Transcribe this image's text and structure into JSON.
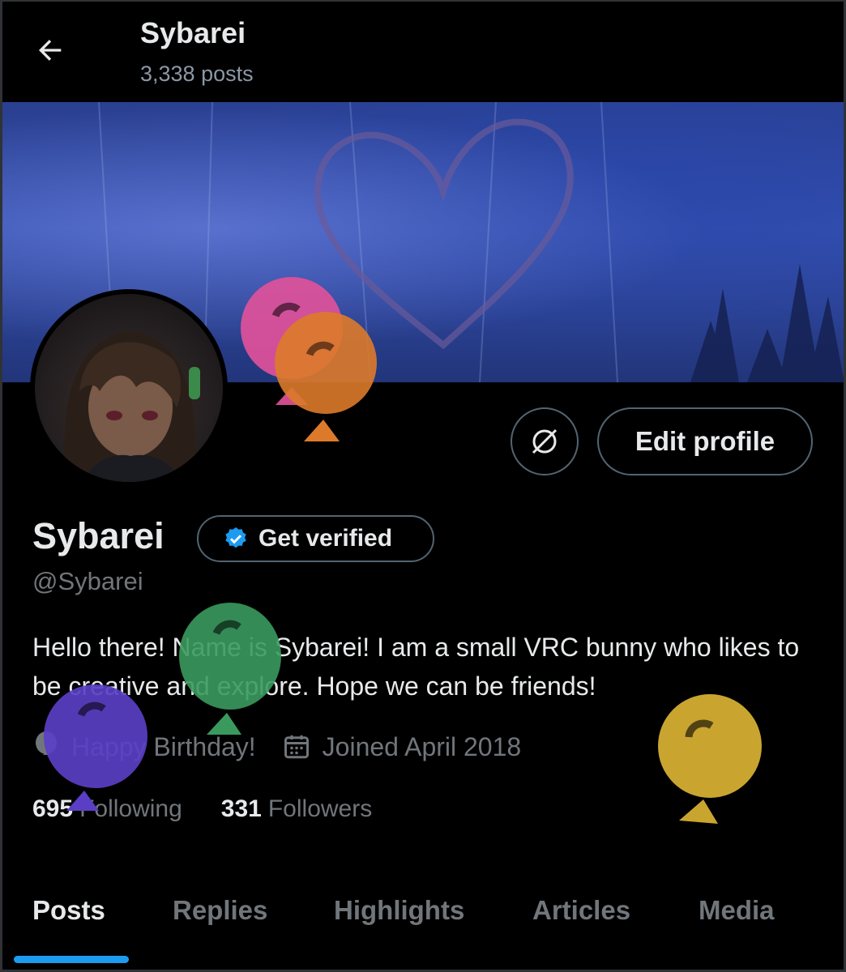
{
  "header": {
    "title": "Sybarei",
    "post_count": "3,338 posts",
    "back_icon": "arrow-left-icon"
  },
  "profile": {
    "display_name": "Sybarei",
    "handle": "@Sybarei",
    "bio": "Hello there! Name is Sybarei! I am a small VRC bunny who likes to be creative and explore. Hope we can be friends!",
    "get_verified_label": "Get verified",
    "edit_profile_label": "Edit profile",
    "birthday_text": "Happy Birthday!",
    "joined_text": "Joined April 2018",
    "following_count": "695",
    "following_label": "Following",
    "followers_count": "331",
    "followers_label": "Followers"
  },
  "tabs": [
    {
      "label": "Posts",
      "active": true
    },
    {
      "label": "Replies",
      "active": false
    },
    {
      "label": "Highlights",
      "active": false
    },
    {
      "label": "Articles",
      "active": false
    },
    {
      "label": "Media",
      "active": false
    }
  ],
  "colors": {
    "background": "#000000",
    "text_primary": "#e7e9ea",
    "text_secondary": "#71767b",
    "accent": "#1d9bf0",
    "border": "#536471",
    "balloon_pink": "#e0519a",
    "balloon_orange": "#dd7a2a",
    "balloon_green": "#3a9a5e",
    "balloon_purple": "#5a3fc4",
    "balloon_gold": "#c9a530"
  }
}
